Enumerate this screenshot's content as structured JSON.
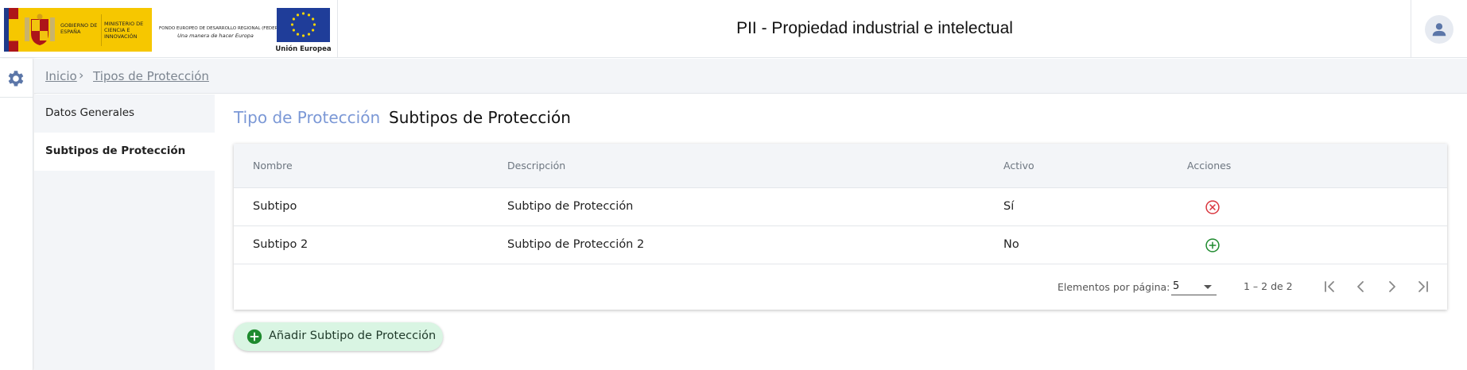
{
  "header": {
    "gob_text1": "GOBIERNO DE ESPAÑA",
    "gob_text2": "MINISTERIO DE CIENCIA E INNOVACIÓN",
    "feder_line1": "FONDO EUROPEO DE DESARROLLO REGIONAL (FEDER)",
    "feder_line2": "Una manera de hacer Europa",
    "eu_label": "Unión Europea",
    "title": "PII - Propiedad industrial e intelectual"
  },
  "breadcrumb": {
    "home": "Inicio",
    "separator": "›",
    "current": "Tipos de Protección"
  },
  "side_menu": {
    "items": [
      {
        "label": "Datos Generales"
      },
      {
        "label": "Subtipos de Protección"
      }
    ]
  },
  "main": {
    "title_entity": "Tipo de Protección",
    "title_section": "Subtipos de Protección"
  },
  "table": {
    "columns": [
      "Nombre",
      "Descripción",
      "Activo",
      "Acciones"
    ],
    "rows": [
      {
        "nombre": "Subtipo",
        "descripcion": "Subtipo de Protección",
        "activo": "Sí",
        "action_icon": "circle-x-icon"
      },
      {
        "nombre": "Subtipo 2",
        "descripcion": "Subtipo de Protección 2",
        "activo": "No",
        "action_icon": "circle-plus-icon"
      }
    ]
  },
  "paginator": {
    "items_per_page_label": "Elementos por página:",
    "page_size": "5",
    "range_label": "1 – 2 de 2"
  },
  "add_button": {
    "label": "Añadir Subtipo de Protección"
  },
  "colors": {
    "accent_title": "#7b98d6",
    "deactivate_red": "#d9363e",
    "activate_green": "#1e8a2e",
    "add_button_bg": "#d9f5e3",
    "add_icon_green": "#1e8a2e",
    "panel_bg": "#f3f5f8"
  },
  "icons": {
    "settings": "gear-icon",
    "user": "user-icon",
    "first_page": "first-page-icon",
    "prev_page": "chevron-left-icon",
    "next_page": "chevron-right-icon",
    "last_page": "last-page-icon"
  }
}
